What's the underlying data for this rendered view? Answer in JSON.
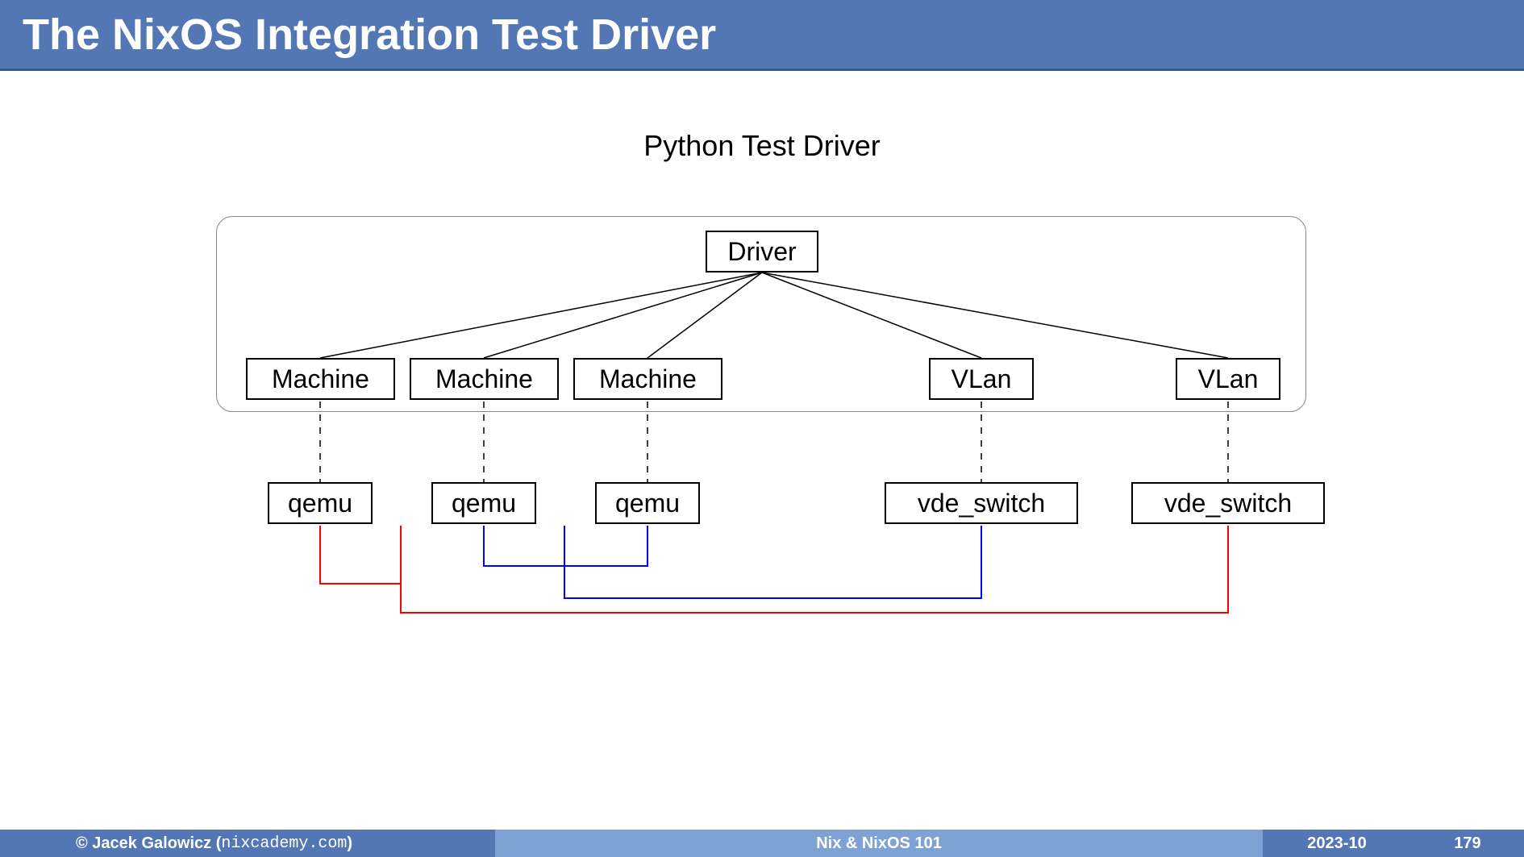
{
  "header": {
    "title": "The NixOS Integration Test Driver"
  },
  "diagram": {
    "title": "Python Test Driver",
    "driver": "Driver",
    "machines": [
      "Machine",
      "Machine",
      "Machine"
    ],
    "vlans": [
      "VLan",
      "VLan"
    ],
    "qemus": [
      "qemu",
      "qemu",
      "qemu"
    ],
    "switches": [
      "vde_switch",
      "vde_switch"
    ]
  },
  "footer": {
    "copyright_prefix": "© Jacek Galowicz (",
    "site": "nixcademy.com",
    "copyright_suffix": ")",
    "title": "Nix & NixOS 101",
    "date": "2023-10",
    "page": "179"
  },
  "colors": {
    "header_bg": "#5377b4",
    "footer_mid_bg": "#7fa2d4",
    "red_line": "#ff0000",
    "blue_line": "#0000ff"
  }
}
